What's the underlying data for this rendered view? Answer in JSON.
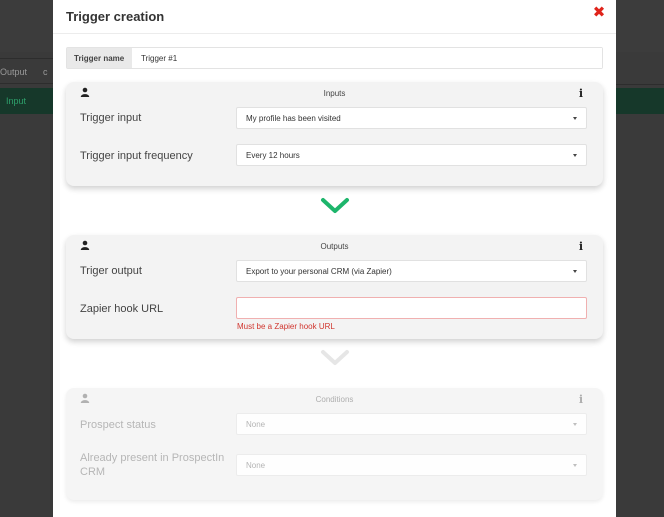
{
  "background": {
    "tab1_label": "Output",
    "tab2_label": "c",
    "green_label": "Input"
  },
  "modal": {
    "title": "Trigger creation",
    "close_glyph": "✖"
  },
  "trigger_name": {
    "label": "Trigger name",
    "value": "Trigger #1"
  },
  "inputs_card": {
    "title": "Inputs",
    "info": "i",
    "fields": [
      {
        "label": "Trigger input",
        "value": "My profile has been visited"
      },
      {
        "label": "Trigger input frequency",
        "value": "Every 12 hours"
      }
    ]
  },
  "outputs_card": {
    "title": "Outputs",
    "info": "i",
    "trigger_output": {
      "label": "Triger output",
      "value": "Export to your personal CRM (via Zapier)"
    },
    "zapier": {
      "label": "Zapier hook URL",
      "value": "",
      "error": "Must be a Zapier hook URL"
    }
  },
  "conditions_card": {
    "title": "Conditions",
    "info": "i",
    "fields": [
      {
        "label": "Prospect status",
        "value": "None"
      },
      {
        "label": "Already present in ProspectIn CRM",
        "value": "None"
      }
    ]
  },
  "colors": {
    "accent_green": "#1db56b",
    "error_red": "#d0362f",
    "close_red": "#e0241b"
  }
}
